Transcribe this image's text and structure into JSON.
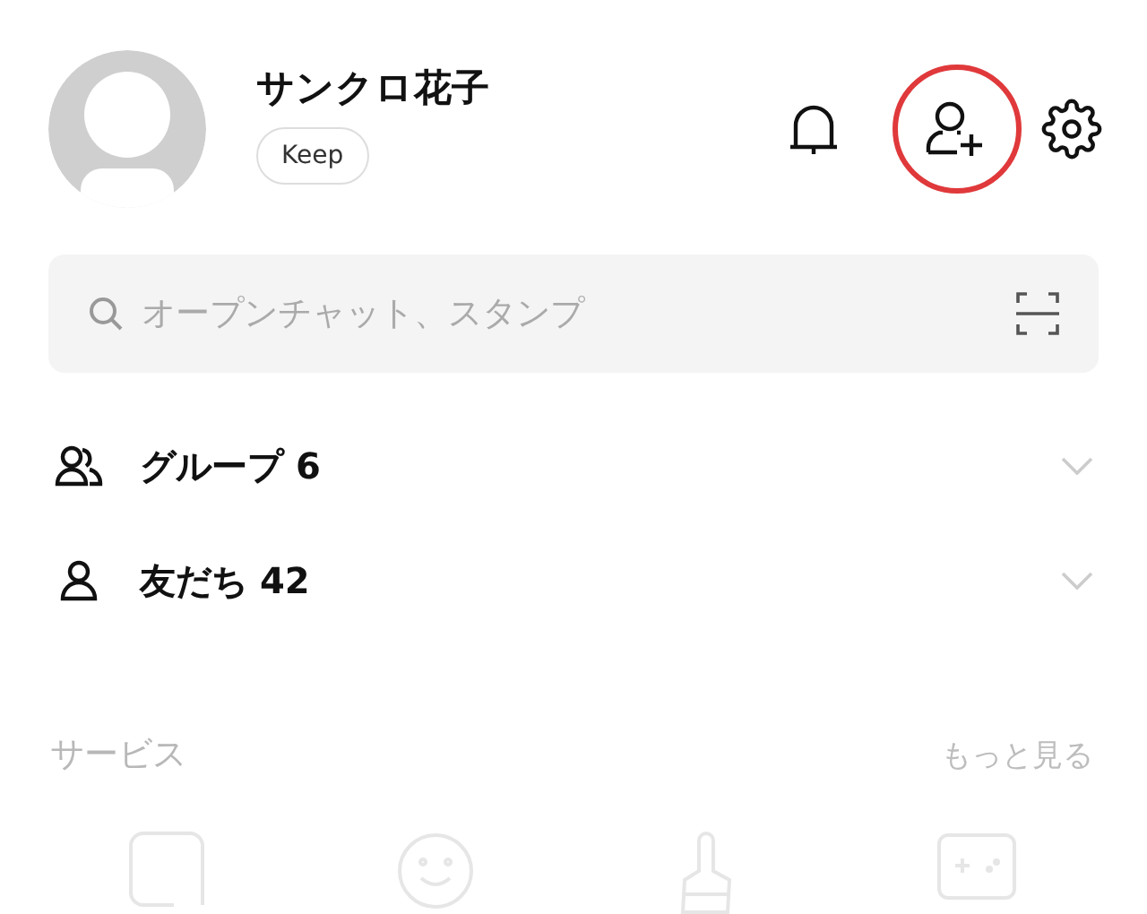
{
  "profile": {
    "name": "サンクロ花子",
    "badge": "Keep"
  },
  "header_actions": [
    {
      "kind": "bell",
      "highlighted": false
    },
    {
      "kind": "addfriend",
      "highlighted": true
    },
    {
      "kind": "gear",
      "highlighted": false
    }
  ],
  "search": {
    "placeholder": "オープンチャット、スタンプ"
  },
  "lists": [
    {
      "kind": "group",
      "label": "グループ 6",
      "expanded": false
    },
    {
      "kind": "friend",
      "label": "友だち 42",
      "expanded": false
    }
  ],
  "services": {
    "title": "サービス",
    "more": "もっと見る",
    "items": [
      {
        "kind": "square"
      },
      {
        "kind": "smile"
      },
      {
        "kind": "brush"
      },
      {
        "kind": "game"
      }
    ]
  }
}
